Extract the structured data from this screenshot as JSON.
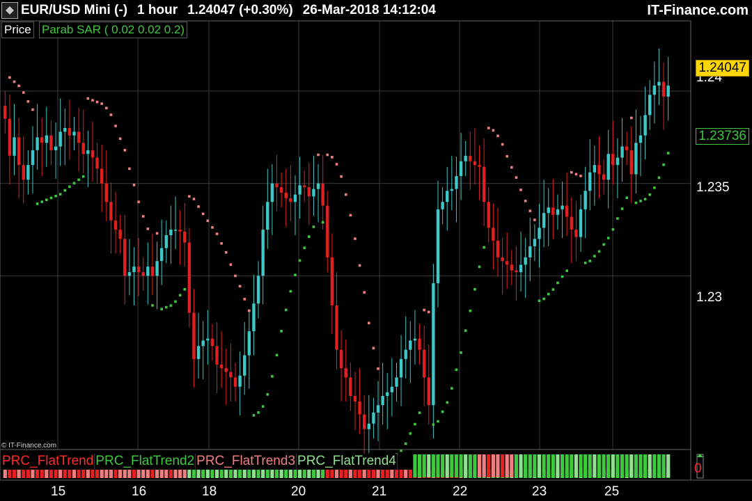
{
  "header": {
    "symbol": "EUR/USD Mini (-)",
    "timeframe": "1 hour",
    "last_price": "1.24047 (+0.30%)",
    "datetime": "26-Mar-2018 14:12:04",
    "brand": "IT-Finance.com"
  },
  "legend": {
    "price_label": "Price",
    "indicator_label": "Parab SAR ( 0.02 0.02 0.2)"
  },
  "copyright": "© IT-Finance.com",
  "y_axis": {
    "ticks": [
      "1.24",
      "1.235",
      "1.23"
    ],
    "last_price_tag": "1.24047",
    "sar_tag": "1.23736"
  },
  "indicator_panel": {
    "labels": [
      "PRC_FlatTrend",
      "PRC_FlatTrend2",
      "PRC_FlatTrend3",
      "PRC_FlatTrend4"
    ],
    "value": "0"
  },
  "x_axis": {
    "labels": [
      "15",
      "16",
      "18",
      "20",
      "21",
      "22",
      "23",
      "25"
    ]
  },
  "colors": {
    "background": "#000000",
    "bull_candle": "#3ec8c8",
    "bear_candle": "#e02020",
    "sar_below": "#3ec83e",
    "sar_above": "#f08080",
    "grid": "#3a3a3a",
    "last_price_tag": "#ffd700"
  },
  "chart_data": {
    "type": "candlestick",
    "ylim": [
      1.2206,
      1.2438
    ],
    "y_ticks": [
      1.23,
      1.235,
      1.24
    ],
    "closes": [
      1.2385,
      1.2365,
      1.2375,
      1.236,
      1.2352,
      1.236,
      1.2368,
      1.2375,
      1.2372,
      1.2376,
      1.2368,
      1.237,
      1.2378,
      1.238,
      1.2376,
      1.2378,
      1.2372,
      1.2366,
      1.2368,
      1.2364,
      1.2358,
      1.235,
      1.234,
      1.233,
      1.2325,
      1.232,
      1.23,
      1.2302,
      1.2305,
      1.2302,
      1.23,
      1.2305,
      1.23,
      1.2308,
      1.2315,
      1.2322,
      1.2325,
      1.2325,
      1.2324,
      1.2318,
      1.228,
      1.2255,
      1.2262,
      1.2265,
      1.2266,
      1.2262,
      1.2252,
      1.225,
      1.2248,
      1.2245,
      1.224,
      1.2246,
      1.2257,
      1.227,
      1.2285,
      1.23,
      1.2325,
      1.234,
      1.235,
      1.2348,
      1.2345,
      1.2342,
      1.234,
      1.2344,
      1.2349,
      1.2348,
      1.2343,
      1.2347,
      1.235,
      1.2338,
      1.231,
      1.2284,
      1.226,
      1.225,
      1.2245,
      1.2235,
      1.2232,
      1.2225,
      1.2217,
      1.222,
      1.2226,
      1.223,
      1.2235,
      1.2237,
      1.224,
      1.2245,
      1.2255,
      1.226,
      1.2265,
      1.2266,
      1.226,
      1.2245,
      1.223,
      1.2296,
      1.2336,
      1.234,
      1.2346,
      1.2347,
      1.2354,
      1.2362,
      1.2365,
      1.2362,
      1.236,
      1.2359,
      1.234,
      1.2326,
      1.2319,
      1.231,
      1.2308,
      1.2306,
      1.2303,
      1.2302,
      1.2306,
      1.231,
      1.2316,
      1.232,
      1.2326,
      1.2334,
      1.2337,
      1.2333,
      1.2336,
      1.2338,
      1.2332,
      1.2325,
      1.2321,
      1.2336,
      1.2346,
      1.2356,
      1.236,
      1.2355,
      1.2352,
      1.2366,
      1.236,
      1.2364,
      1.237,
      1.2368,
      1.2355,
      1.2372,
      1.2376,
      1.2387,
      1.2398,
      1.2403,
      1.2405,
      1.2397,
      1.2403
    ]
  }
}
